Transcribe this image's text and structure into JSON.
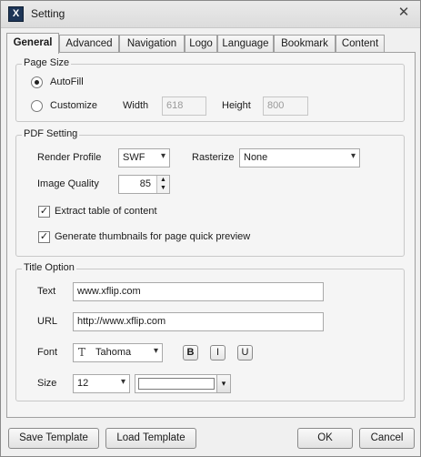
{
  "window": {
    "title": "Setting",
    "app_icon_letter": "X"
  },
  "tabs": [
    "General",
    "Advanced",
    "Navigation",
    "Logo",
    "Language",
    "Bookmark",
    "Content"
  ],
  "page_size": {
    "group_title": "Page Size",
    "autofill_label": "AutoFill",
    "customize_label": "Customize",
    "selected": "AutoFill",
    "width_label": "Width",
    "width_value": "618",
    "height_label": "Height",
    "height_value": "800"
  },
  "pdf_setting": {
    "group_title": "PDF Setting",
    "render_profile_label": "Render Profile",
    "render_profile_value": "SWF",
    "rasterize_label": "Rasterize",
    "rasterize_value": "None",
    "image_quality_label": "Image Quality",
    "image_quality_value": "85",
    "extract_toc_label": "Extract table of content",
    "extract_toc_checked": true,
    "thumbnails_label": "Generate thumbnails for page quick preview",
    "thumbnails_checked": true
  },
  "title_option": {
    "group_title": "Title Option",
    "text_label": "Text",
    "text_value": "www.xflip.com",
    "url_label": "URL",
    "url_value": "http://www.xflip.com",
    "font_label": "Font",
    "font_value": "Tahoma",
    "bold_label": "B",
    "italic_label": "I",
    "underline_label": "U",
    "size_label": "Size",
    "size_value": "12",
    "color_value": "#ffffff"
  },
  "buttons": {
    "save_template": "Save Template",
    "load_template": "Load Template",
    "ok": "OK",
    "cancel": "Cancel"
  },
  "glyphs": {
    "check": "✓",
    "dropdown": "▾",
    "spin_up": "▲",
    "spin_down": "▼",
    "close": "✕"
  }
}
